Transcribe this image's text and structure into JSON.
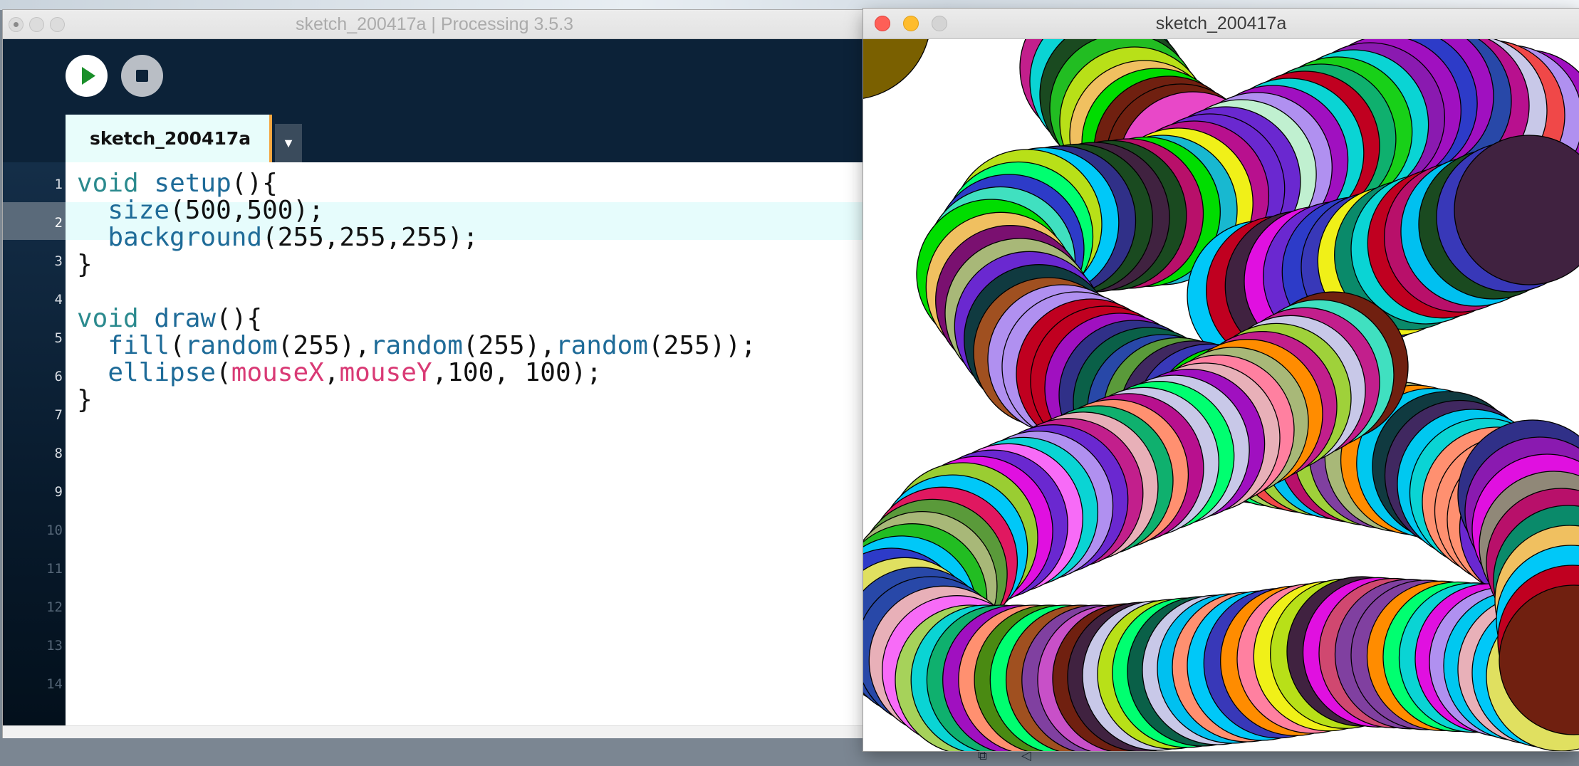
{
  "editor": {
    "window_title": "sketch_200417a | Processing 3.5.3",
    "tab_label": "sketch_200417a",
    "tab_menu_glyph": "▼",
    "toolbar": {
      "run_icon": "play-icon",
      "stop_icon": "stop-icon"
    },
    "line_numbers": [
      "1",
      "2",
      "3",
      "4",
      "5",
      "6",
      "7",
      "8",
      "9",
      "10",
      "11",
      "12",
      "13",
      "14"
    ],
    "active_line": 2,
    "colors": {
      "toolbar_bg": "#0c2238",
      "keyword": "#2b8a8e",
      "function": "#1e6b98",
      "variable": "#d93a75",
      "tab_accent": "#f4a640",
      "run_green": "#1a8f2a"
    }
  },
  "code": {
    "l1_kw": "void",
    "l1_fn": "setup",
    "l1_rest": "(){",
    "l2_fn": "size",
    "l2_rest": "(500,500);",
    "l3_fn": "background",
    "l3_rest": "(255,255,255);",
    "l4": "}",
    "l6_kw": "void",
    "l6_fn": "draw",
    "l6_rest": "(){",
    "l7_fn1": "fill",
    "l7_p1": "(",
    "l7_fn2": "random",
    "l7_p2": "(255),",
    "l7_fn3": "random",
    "l7_p3": "(255),",
    "l7_fn4": "random",
    "l7_p4": "(255));",
    "l8_fn": "ellipse",
    "l8_p1": "(",
    "l8_v1": "mouseX",
    "l8_p2": ",",
    "l8_v2": "mouseY",
    "l8_p3": ",100, 100);",
    "l9": "}"
  },
  "sketch_window": {
    "title": "sketch_200417a",
    "buttons": [
      "close-button",
      "minimize-button",
      "zoom-button"
    ]
  },
  "desktop": {
    "icon_a": "⧉",
    "icon_b": "◁"
  }
}
